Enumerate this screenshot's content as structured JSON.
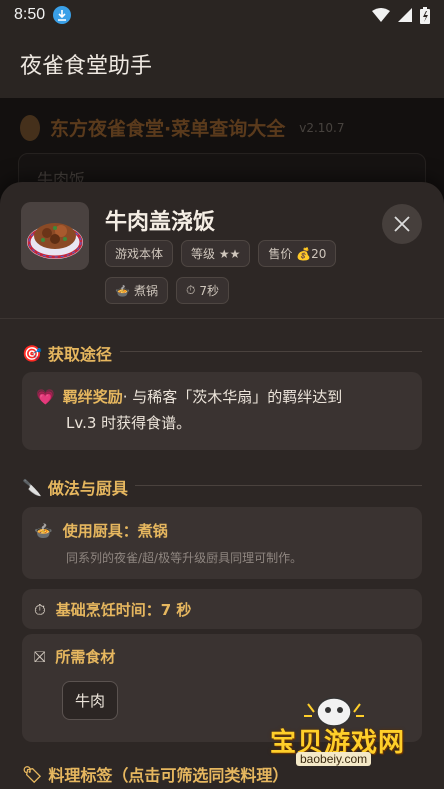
{
  "status_bar": {
    "time": "8:50"
  },
  "app_bar": {
    "title": "夜雀食堂助手"
  },
  "background_page": {
    "title": "东方夜雀食堂·菜单查询大全",
    "version": "v2.10.7",
    "select_value": "牛肉饭"
  },
  "sheet": {
    "dish_name": "牛肉盖浇饭",
    "chips": {
      "source": "游戏本体",
      "level": "等级 ★★",
      "price": "售价 💰20",
      "cooker": "煮锅",
      "time": "7秒"
    },
    "acquire": {
      "title": "获取途径",
      "bond_label": "羁绊奖励",
      "bond_text": "· 与稀客「茨木华扇」的羁绊达到",
      "bond_text2": "Lv.3 时获得食谱。"
    },
    "method": {
      "title": "做法与厨具",
      "tool_label": "使用厨具：煮锅",
      "tool_note": "同系列的夜雀/超/极等升级厨具同理可制作。",
      "time_label": "基础烹饪时间：7 秒",
      "ingredients_label": "所需食材",
      "ingredients": [
        "牛肉"
      ]
    },
    "tags": {
      "title": "料理标签（点击可筛选同类料理）"
    }
  },
  "watermark": {
    "text": "宝贝游戏网",
    "url": "baobeiy.com"
  },
  "colors": {
    "accent": "#e6b75f",
    "sheet_bg": "#2d2725",
    "card_bg": "#3a3331"
  }
}
